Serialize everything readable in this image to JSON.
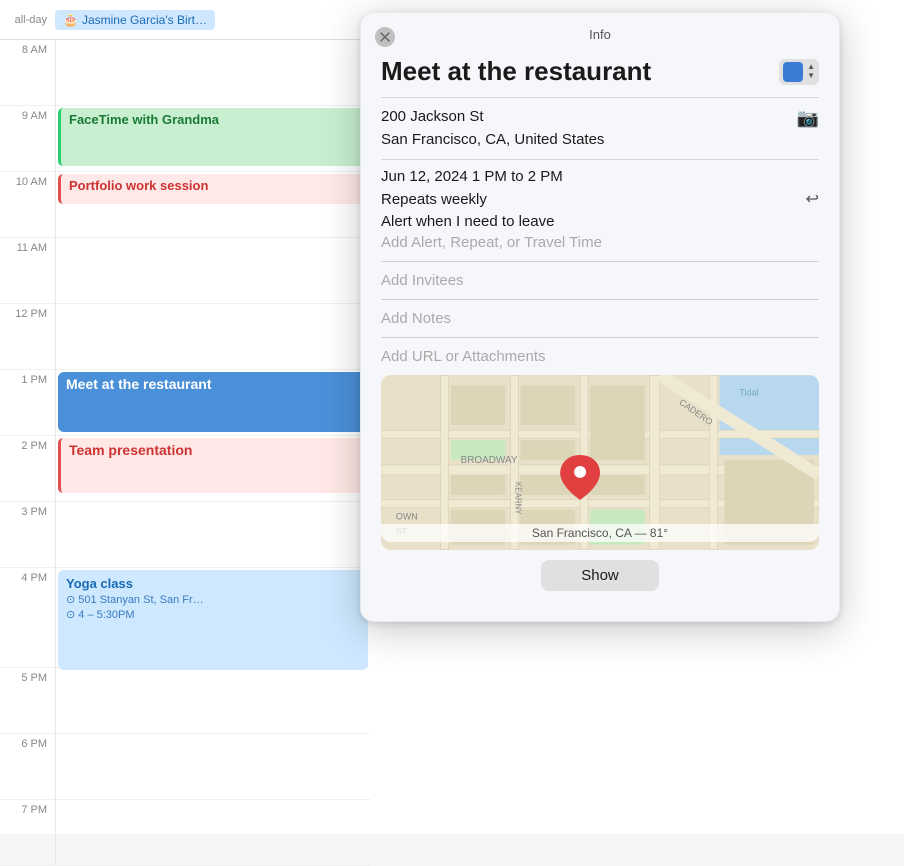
{
  "popup": {
    "info_label": "Info",
    "close_label": "×",
    "event_title": "Meet at the restaurant",
    "location_line1": "200 Jackson St",
    "location_line2": "San Francisco, CA, United States",
    "datetime": "Jun 12, 2024  1 PM to 2 PM",
    "repeats": "Repeats weekly",
    "alert": "Alert when I need to leave",
    "add_alert": "Add Alert, Repeat, or Travel Time",
    "add_invitees": "Add Invitees",
    "add_notes": "Add Notes",
    "add_url": "Add URL or Attachments",
    "map_caption": "San Francisco, CA — 81°",
    "show_button": "Show"
  },
  "calendar": {
    "allday_label": "all-day",
    "allday_event": "Jasmine Garcia's Birt…",
    "times": [
      {
        "label": "8 AM"
      },
      {
        "label": "9 AM"
      },
      {
        "label": "10 AM"
      },
      {
        "label": "11 AM"
      },
      {
        "label": "12 PM"
      },
      {
        "label": "1 PM"
      },
      {
        "label": "2 PM"
      },
      {
        "label": "3 PM"
      },
      {
        "label": "4 PM"
      },
      {
        "label": "5 PM"
      },
      {
        "label": "6 PM"
      },
      {
        "label": "7 PM"
      }
    ],
    "events": {
      "facetime": "FaceTime with Grandma",
      "portfolio": "Portfolio work session",
      "restaurant": "Meet at the restaurant",
      "team": "Team presentation",
      "yoga": "Yoga class",
      "yoga_address": "501 Stanyan St, San Fr…",
      "yoga_time": "4 – 5:30PM"
    }
  }
}
